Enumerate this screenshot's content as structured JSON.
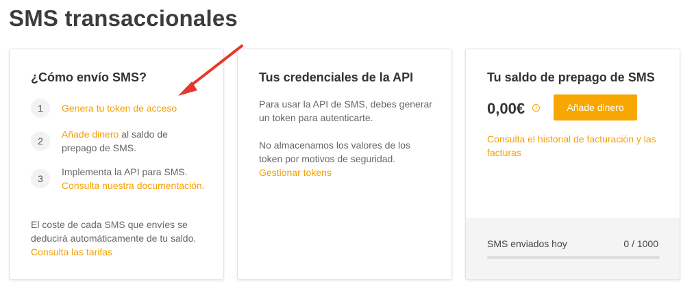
{
  "page": {
    "title": "SMS transaccionales"
  },
  "how_to": {
    "title": "¿Cómo envío SMS?",
    "steps": [
      {
        "number": "1",
        "link": "Genera tu token de acceso"
      },
      {
        "number": "2",
        "link": "Añade dinero",
        "text": " al saldo de prepago de SMS."
      },
      {
        "number": "3",
        "text": "Implementa la API para SMS. ",
        "link": "Consulta nuestra documentación."
      }
    ],
    "cost_text": "El coste de cada SMS que envíes se deducirá automáticamente de tu saldo. ",
    "cost_link": "Consulta las tarifas"
  },
  "credentials": {
    "title": "Tus credenciales de la API",
    "p1": "Para usar la API de SMS, debes generar un token para autenticarte.",
    "p2": "No almacenamos los valores de los token por motivos de seguridad. ",
    "p2_link": "Gestionar tokens"
  },
  "balance": {
    "title": "Tu saldo de prepago de SMS",
    "amount": "0,00€",
    "info_icon": "i",
    "add_button": "Añade dinero",
    "history_link": "Consulta el historial de facturación y las facturas",
    "sent_label": "SMS enviados hoy",
    "sent_count": "0 / 1000",
    "sent_progress": 0
  },
  "colors": {
    "accent": "#f5a000",
    "arrow": "#e8372c"
  }
}
